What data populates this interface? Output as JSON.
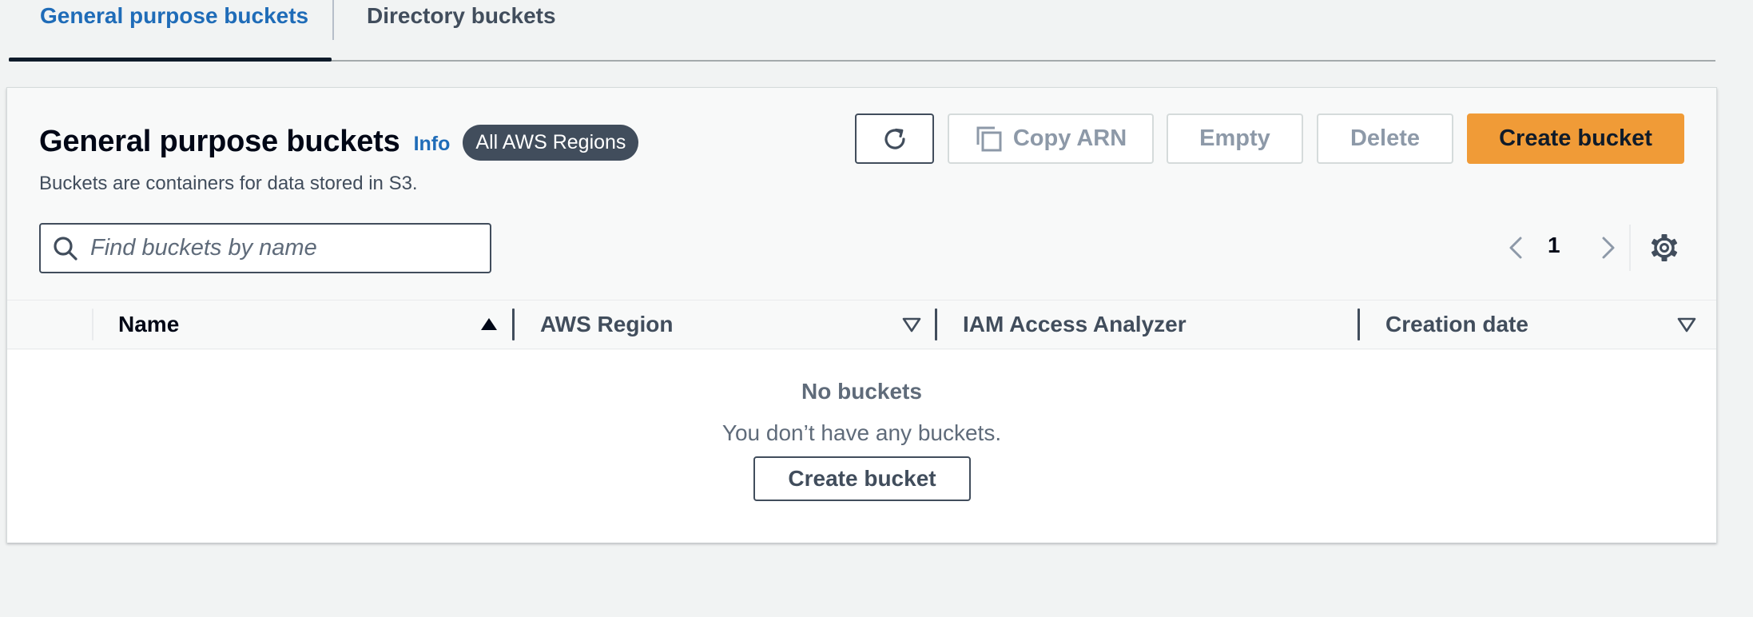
{
  "tabs": [
    {
      "label": "General purpose buckets",
      "active": true
    },
    {
      "label": "Directory buckets",
      "active": false
    }
  ],
  "header": {
    "title": "General purpose buckets",
    "info": "Info",
    "region_badge": "All AWS Regions",
    "subtitle": "Buckets are containers for data stored in S3."
  },
  "toolbar": {
    "refresh_icon": "refresh-icon",
    "copy_arn_label": "Copy ARN",
    "copy_icon": "copy-icon",
    "empty_label": "Empty",
    "delete_label": "Delete",
    "create_label": "Create bucket"
  },
  "search": {
    "placeholder": "Find buckets by name",
    "value": ""
  },
  "pagination": {
    "current_page": "1",
    "prev_icon": "chevron-left-icon",
    "next_icon": "chevron-right-icon",
    "settings_icon": "gear-icon"
  },
  "table": {
    "columns": [
      {
        "label": "Name",
        "sort": "ascending"
      },
      {
        "label": "AWS Region",
        "sort": "sortable"
      },
      {
        "label": "IAM Access Analyzer",
        "sort": "none"
      },
      {
        "label": "Creation date",
        "sort": "sortable"
      }
    ],
    "rows": [],
    "empty": {
      "title": "No buckets",
      "description": "You don’t have any buckets.",
      "create_label": "Create bucket"
    }
  },
  "colors": {
    "accent_link": "#1f6cb8",
    "primary_button": "#f09b37",
    "badge_bg": "#414d5c",
    "disabled_text": "#8d99a8"
  }
}
